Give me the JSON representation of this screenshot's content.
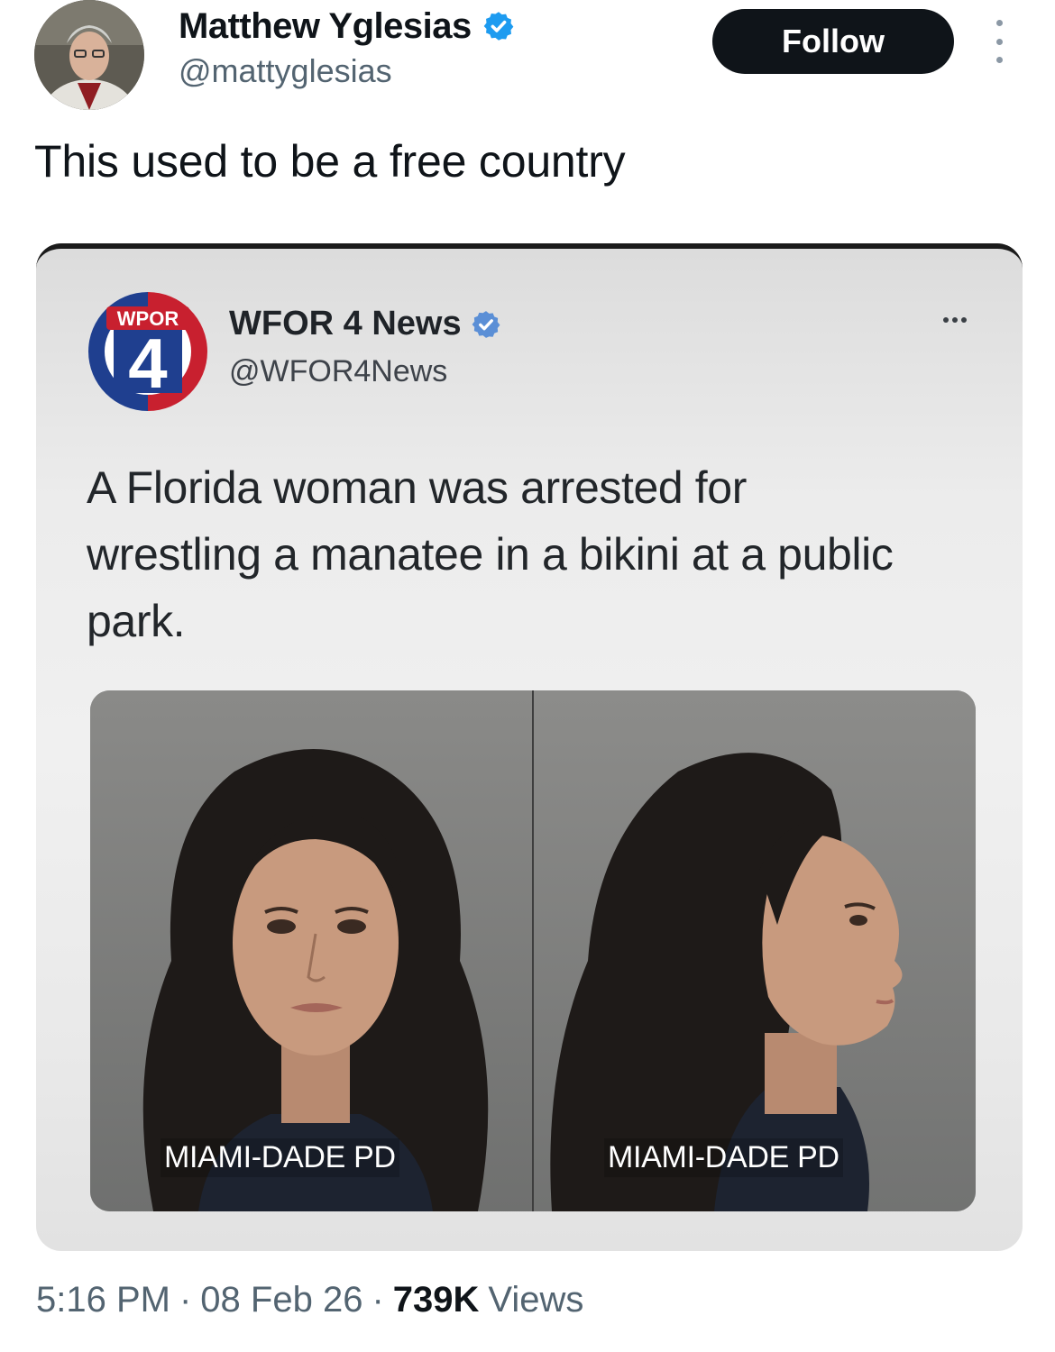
{
  "tweet": {
    "author": {
      "display_name": "Matthew Yglesias",
      "handle": "@mattyglesias",
      "verified": true,
      "avatar_icon": "profile-photo"
    },
    "follow_label": "Follow",
    "more_icon": "more-vertical-icon",
    "text": "This used to be a free country",
    "meta": {
      "time": "5:16 PM",
      "date": "08 Feb 26",
      "views_count": "739K",
      "views_label": "Views",
      "separator": "·"
    }
  },
  "embedded_post": {
    "logo_text": "WPOR",
    "logo_number": "4",
    "display_name": "WFOR 4 News",
    "handle": "@WFOR4News",
    "verified": true,
    "text": "A Florida woman was arrested for wrestling a manatee in a bikini at a public park.",
    "images": [
      {
        "caption": "MIAMI-DADE PD"
      },
      {
        "caption": "MIAMI-DADE PD"
      }
    ]
  },
  "colors": {
    "verified_blue": "#1d9bf0",
    "follow_bg": "#0f1419",
    "secondary_text": "#536471",
    "logo_red": "#c8202f",
    "logo_blue": "#1f3f8f"
  }
}
